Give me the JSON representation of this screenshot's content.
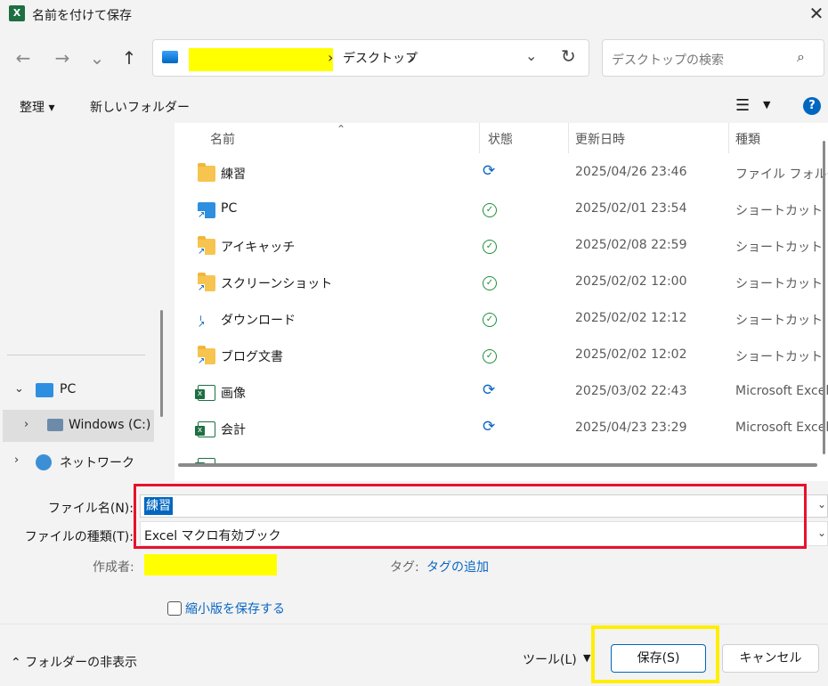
{
  "window": {
    "title": "名前を付けて保存",
    "app_icon": "X"
  },
  "nav": {
    "back": "←",
    "forward": "→",
    "recent": "⌄",
    "up": "↑"
  },
  "address": {
    "location": "デスクトップ"
  },
  "search": {
    "placeholder": "デスクトップの検索"
  },
  "toolbar": {
    "organize": "整理 ▾",
    "new_folder": "新しいフォルダー"
  },
  "columns": {
    "name": "名前",
    "status": "状態",
    "modified": "更新日時",
    "type": "種類"
  },
  "files": [
    {
      "name": "練習",
      "icon": "folder-icon",
      "status": "sync",
      "date": "2025/04/26 23:46",
      "type": "ファイル フォルダー"
    },
    {
      "name": "PC",
      "icon": "pc-shortcut-icon",
      "status": "ok",
      "date": "2025/02/01 23:54",
      "type": "ショートカット"
    },
    {
      "name": "アイキャッチ",
      "icon": "folder-shortcut-icon",
      "status": "ok",
      "date": "2025/02/08 22:59",
      "type": "ショートカット"
    },
    {
      "name": "スクリーンショット",
      "icon": "folder-shortcut-icon",
      "status": "ok",
      "date": "2025/02/02 12:00",
      "type": "ショートカット"
    },
    {
      "name": "ダウンロード",
      "icon": "download-shortcut-icon",
      "status": "ok",
      "date": "2025/02/02 12:12",
      "type": "ショートカット"
    },
    {
      "name": "ブログ文書",
      "icon": "folder-shortcut-icon",
      "status": "ok",
      "date": "2025/02/02 12:02",
      "type": "ショートカット"
    },
    {
      "name": "画像",
      "icon": "excel-file-icon",
      "status": "sync",
      "date": "2025/03/02 22:43",
      "type": "Microsoft Excel"
    },
    {
      "name": "会計",
      "icon": "excel-file-icon",
      "status": "sync",
      "date": "2025/04/23 23:29",
      "type": "Microsoft Excel"
    }
  ],
  "tree": {
    "pc": "PC",
    "windows": "Windows (C:)",
    "network": "ネットワーク"
  },
  "form": {
    "filename_label": "ファイル名(N):",
    "filename_value": "練習",
    "filetype_label": "ファイルの種類(T):",
    "filetype_value": "Excel マクロ有効ブック",
    "author_label": "作成者:",
    "tags_label": "タグ:",
    "tags_link": "タグの追加",
    "thumbnail_label": "縮小版を保存する"
  },
  "footer": {
    "hide_folders": "フォルダーの非表示",
    "tools": "ツール(L)",
    "save": "保存(S)",
    "cancel": "キャンセル"
  },
  "colors": {
    "accent": "#0067c0",
    "highlight_red": "#e8112d",
    "highlight_yellow": "#ffee00",
    "redaction": "#ffff00"
  }
}
